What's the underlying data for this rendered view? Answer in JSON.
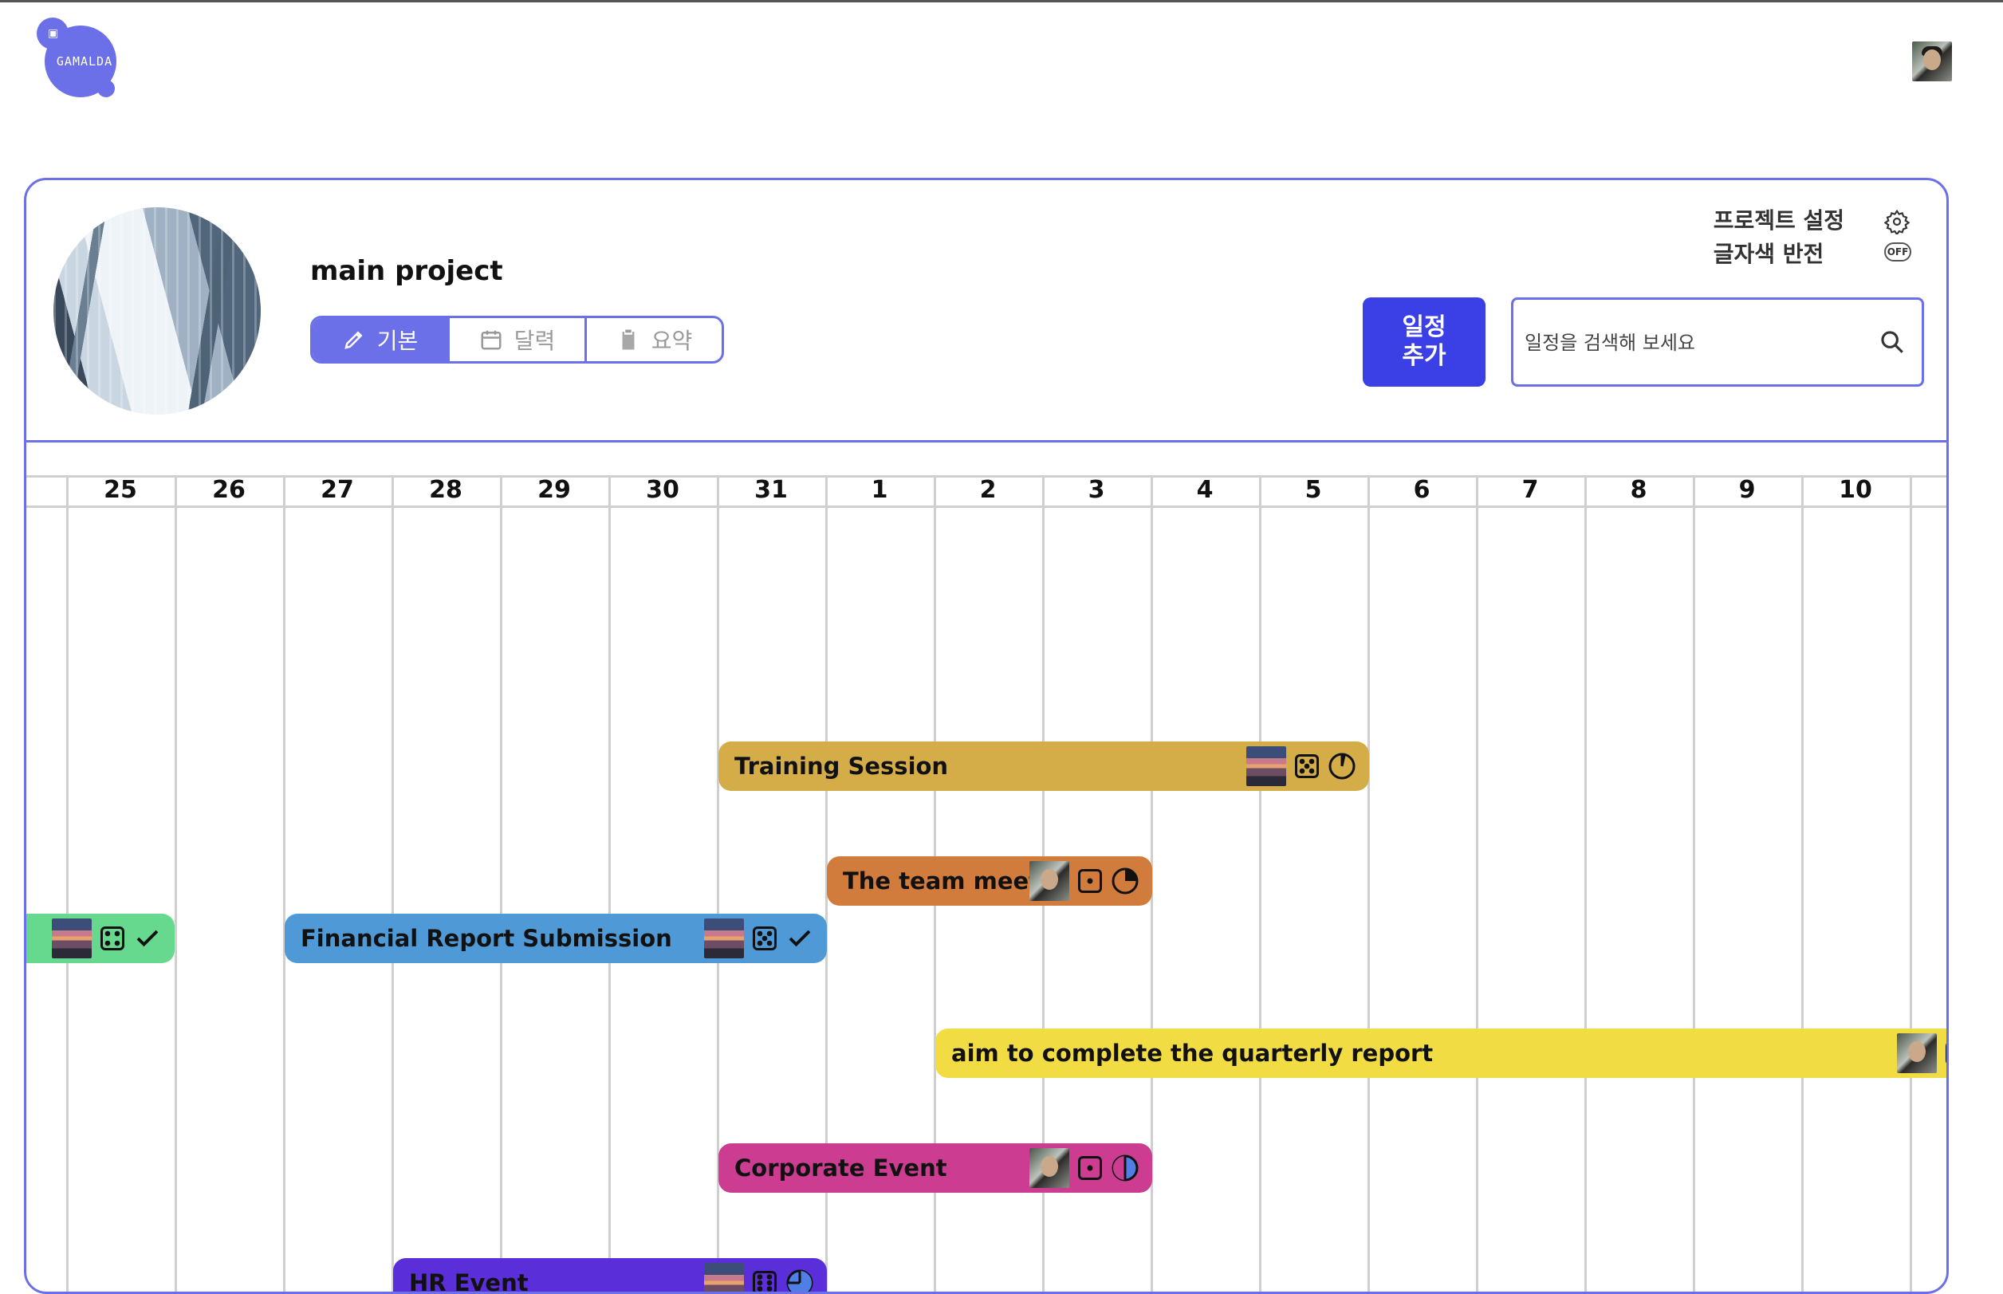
{
  "logo": {
    "text": "GAMALDA"
  },
  "project": {
    "title": "main project",
    "tabs": [
      {
        "label": "기본",
        "icon": "pencil-icon",
        "active": true
      },
      {
        "label": "달력",
        "icon": "calendar-icon",
        "active": false
      },
      {
        "label": "요약",
        "icon": "clipboard-icon",
        "active": false
      }
    ],
    "settings_label": "프로젝트 설정",
    "invert_label": "글자색 반전",
    "invert_state": "OFF"
  },
  "actions": {
    "add_schedule": "일정\n추가",
    "search_placeholder": "일정을 검색해 보세요"
  },
  "timeline": {
    "days": [
      "25",
      "26",
      "27",
      "28",
      "29",
      "30",
      "31",
      "1",
      "2",
      "3",
      "4",
      "5",
      "6",
      "7",
      "8",
      "9",
      "10"
    ]
  },
  "events": [
    {
      "title": "Training Session",
      "color": "#d4ad49",
      "avatar": "sunset-photo",
      "status_icon": "dice-five-icon",
      "progress_icon": "progress-quarter-icon"
    },
    {
      "title": "The team meeting",
      "color": "#d17c3d",
      "avatar": "person-photo",
      "status_icon": "dice-one-icon",
      "progress_icon": "progress-quarter-icon"
    },
    {
      "title": "",
      "color": "#67d98e",
      "avatar": "sunset-photo",
      "status_icon": "dice-four-icon",
      "progress_icon": "check-icon"
    },
    {
      "title": "Financial Report Submission",
      "color": "#4f9ad6",
      "avatar": "sunset-photo",
      "status_icon": "dice-five-icon",
      "progress_icon": "check-icon"
    },
    {
      "title": "aim to complete the quarterly report",
      "color": "#f2dc44",
      "avatar": "person-photo",
      "status_icon": "dice-one-icon",
      "progress_icon": ""
    },
    {
      "title": "Corporate Event",
      "color": "#cc3d91",
      "avatar": "person-photo",
      "status_icon": "dice-one-icon",
      "progress_icon": "progress-half-icon"
    },
    {
      "title": "HR Event",
      "color": "#5a2ed8",
      "avatar": "sunset-photo",
      "status_icon": "dice-six-icon",
      "progress_icon": "progress-three-quarter-icon"
    }
  ]
}
